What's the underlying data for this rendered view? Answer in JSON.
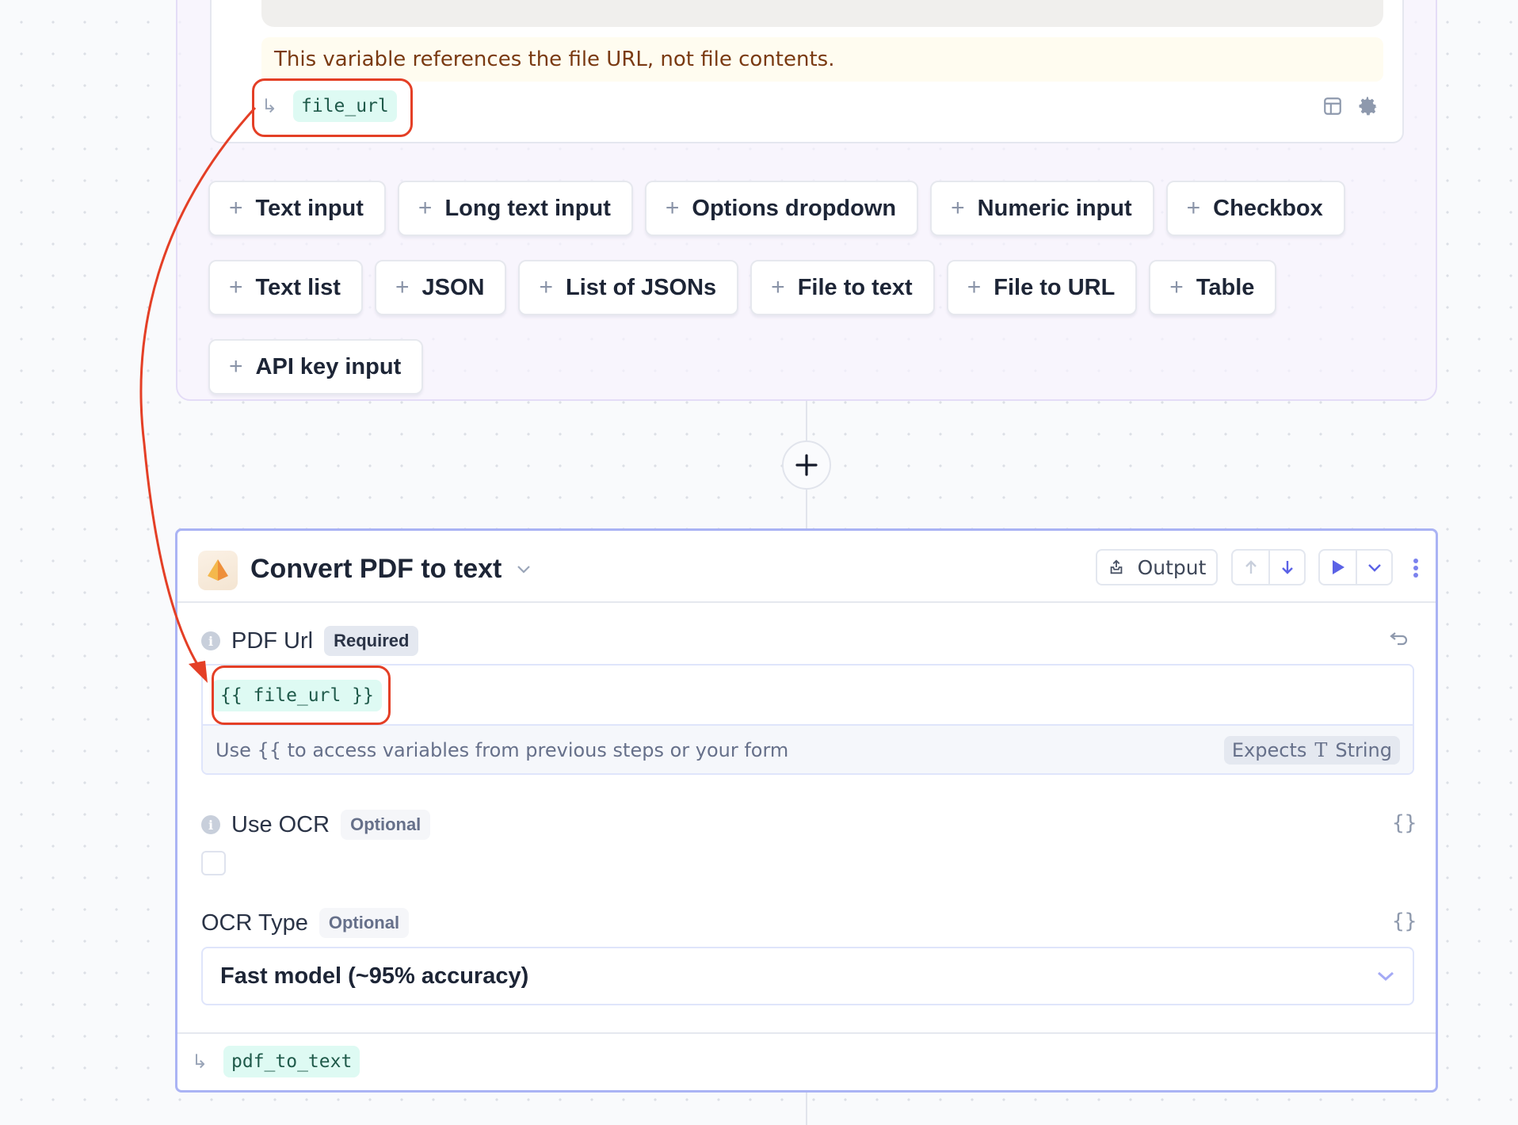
{
  "form_panel": {
    "notice": "This variable references the file URL, not file contents.",
    "variable_name": "file_url",
    "icons": [
      "table-icon",
      "gear-icon"
    ],
    "add_field_buttons": [
      "Text input",
      "Long text input",
      "Options dropdown",
      "Numeric input",
      "Checkbox",
      "Text list",
      "JSON",
      "List of JSONs",
      "File to text",
      "File to URL",
      "Table",
      "API key input"
    ]
  },
  "add_step": {
    "icon": "plus-icon"
  },
  "step": {
    "title": "Convert PDF to text",
    "icon": "pyramid-icon",
    "output_label": "Output",
    "accent_color": "#6366f1",
    "fields": {
      "pdf_url": {
        "label": "PDF Url",
        "badge": "Required",
        "value": "{{ file_url }}",
        "hint": "Use {{ to access variables from previous steps or your form",
        "expects_label": "Expects",
        "expects_type_glyph": "T",
        "expects_type": "String"
      },
      "use_ocr": {
        "label": "Use OCR",
        "badge": "Optional",
        "checked": false
      },
      "ocr_type": {
        "label": "OCR Type",
        "badge": "Optional",
        "selected": "Fast model (~95% accuracy)"
      }
    },
    "output_variable": "pdf_to_text"
  },
  "annotation": {
    "color": "#e43f26",
    "description": "Arrow from file_url variable to {{ file_url }} input"
  }
}
